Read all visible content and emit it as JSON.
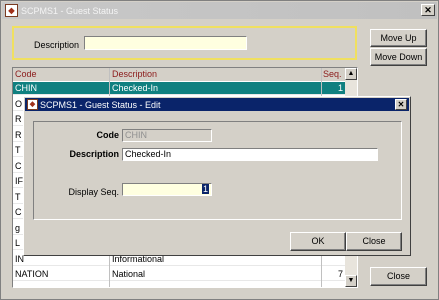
{
  "main_window": {
    "title": "SCPMS1 - Guest Status",
    "icon": "app-icon"
  },
  "search": {
    "description_label": "Description",
    "description_value": ""
  },
  "side_buttons": {
    "move_up": "Move Up",
    "move_down": "Move Down",
    "close": "Close"
  },
  "grid": {
    "columns": [
      "Code",
      "Description",
      "Seq."
    ],
    "rows": [
      {
        "code": "CHIN",
        "description": "Checked-In",
        "seq": "1",
        "selected": true
      },
      {
        "code": "O",
        "description": "",
        "seq": ""
      },
      {
        "code": "R",
        "description": "",
        "seq": ""
      },
      {
        "code": "R",
        "description": "",
        "seq": ""
      },
      {
        "code": "T",
        "description": "",
        "seq": ""
      },
      {
        "code": "C",
        "description": "",
        "seq": ""
      },
      {
        "code": "IF",
        "description": "",
        "seq": ""
      },
      {
        "code": "T",
        "description": "",
        "seq": ""
      },
      {
        "code": "C",
        "description": "",
        "seq": ""
      },
      {
        "code": "g",
        "description": "",
        "seq": ""
      },
      {
        "code": "L",
        "description": "",
        "seq": ""
      },
      {
        "code": "IN",
        "description": "Informational",
        "seq": ""
      },
      {
        "code": "NATION",
        "description": "National",
        "seq": "7"
      }
    ]
  },
  "dialog": {
    "title": "SCPMS1 - Guest Status - Edit",
    "code_label": "Code",
    "code_value": "CHIN",
    "description_label": "Description",
    "description_value": "Checked-In",
    "display_seq_label": "Display Seq.",
    "display_seq_value": "1",
    "ok": "OK",
    "close": "Close"
  }
}
